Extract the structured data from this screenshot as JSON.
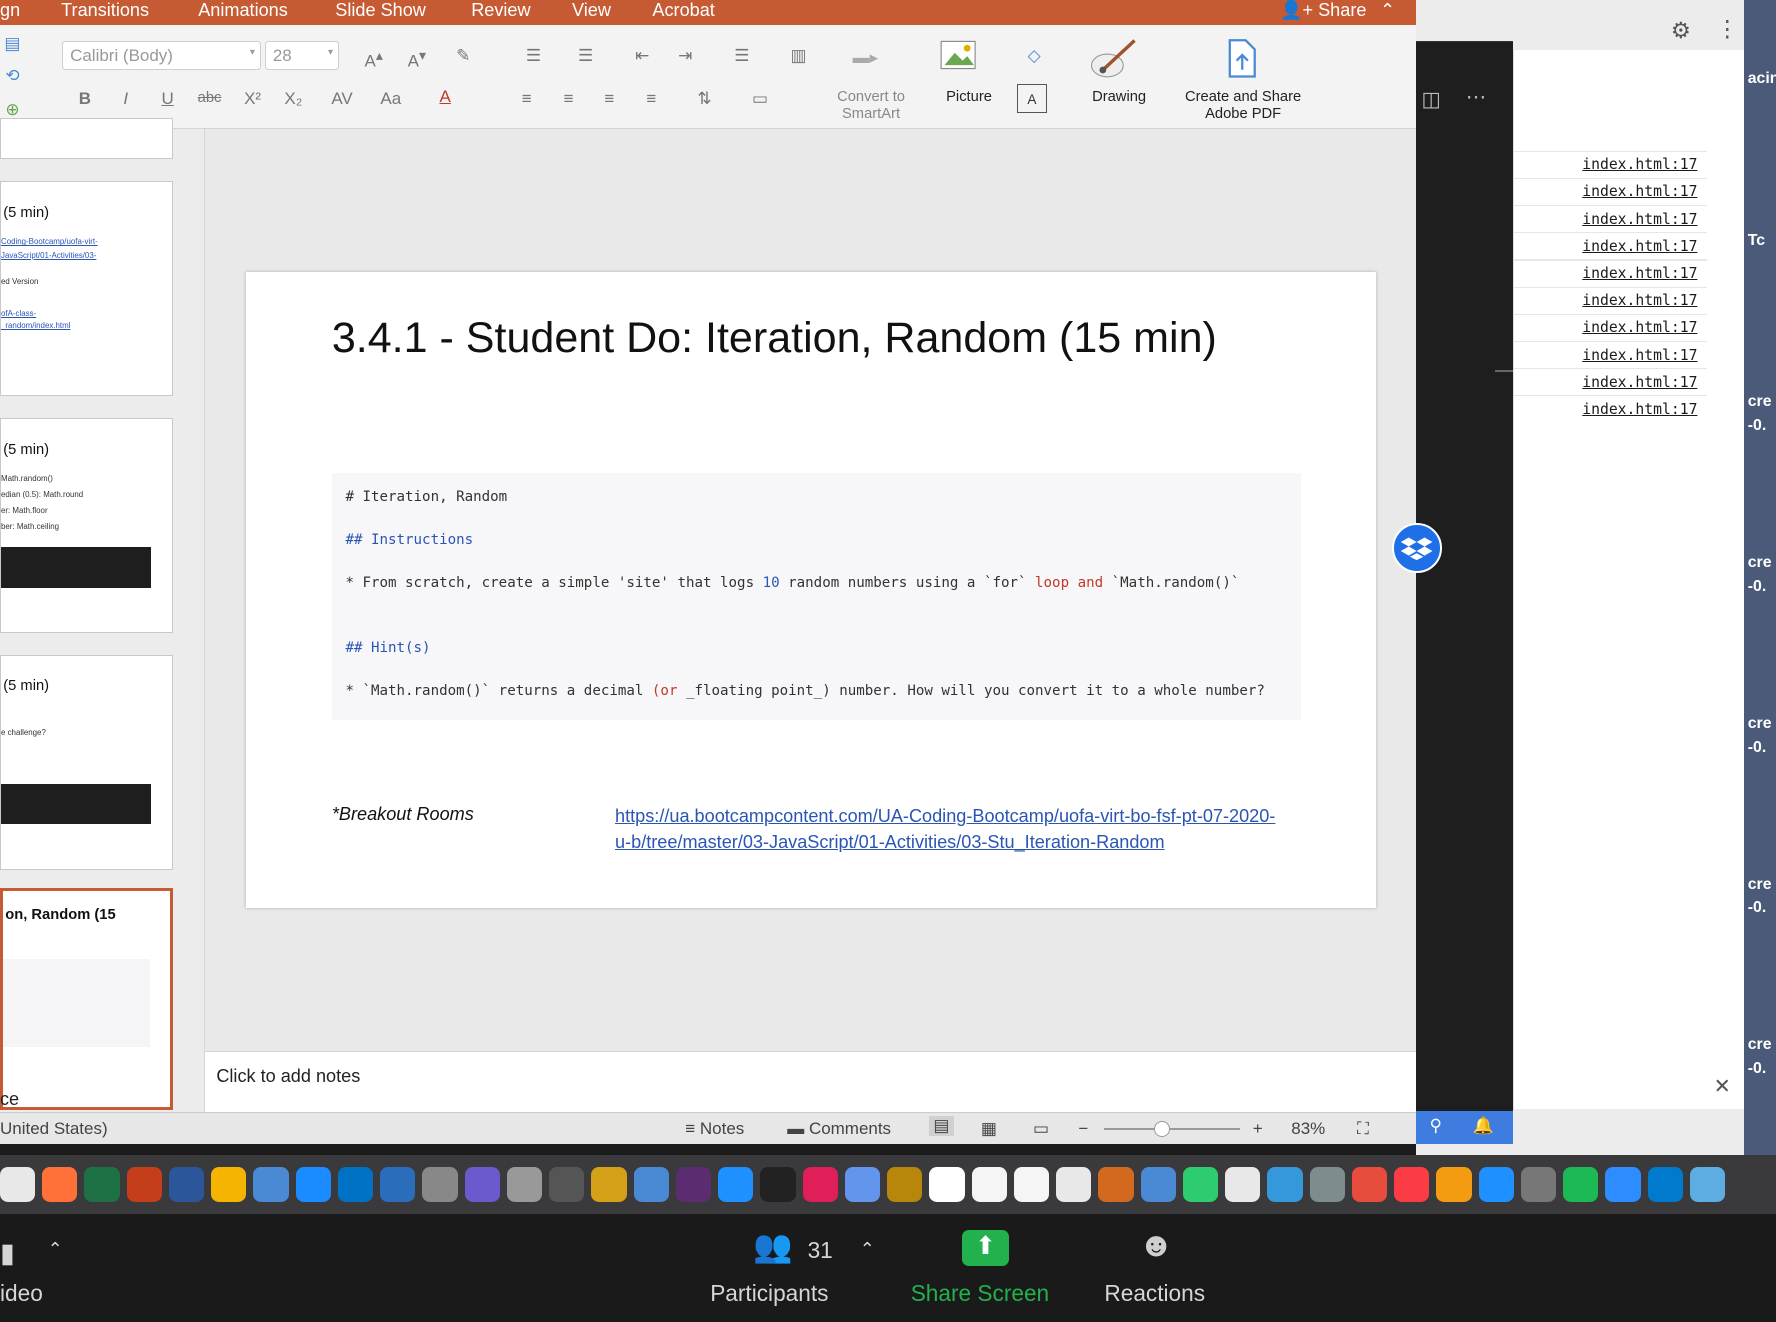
{
  "ppt": {
    "menu": [
      "gn",
      "Transitions",
      "Animations",
      "Slide Show",
      "Review",
      "View",
      "Acrobat"
    ],
    "share_label": "Share",
    "font_name": "Calibri (Body)",
    "font_size": "28",
    "ribbon_labels": {
      "convert_line1": "Convert to",
      "convert_line2": "SmartArt",
      "picture": "Picture",
      "drawing": "Drawing",
      "adobe_line1": "Create and Share",
      "adobe_line2": "Adobe PDF"
    }
  },
  "thumbnails": [
    {
      "title": "(5 min)",
      "lines": [
        "Coding-Bootcamp/uofa-virt-",
        "JavaScript/01-Activities/03-",
        "ed Version",
        "ofA-class-",
        "_random/index.html"
      ]
    },
    {
      "title": "(5 min)",
      "lines": [
        "Math.random()",
        "edian (0.5): Math.round",
        "er: Math.floor",
        "ber: Math.ceiling"
      ]
    },
    {
      "title": "(5 min)",
      "lines": [
        "e challenge?"
      ]
    },
    {
      "title": "on, Random (15",
      "lines": []
    }
  ],
  "slide": {
    "title": "3.4.1 - Student Do: Iteration, Random (15 min)",
    "code": {
      "h1": "# Iteration, Random",
      "h2_instructions": "## Instructions",
      "bullet1_a": "* From scratch, create a simple 'site' that logs ",
      "bullet1_num": "10",
      "bullet1_b": " random numbers using a `for` ",
      "bullet1_kw": "loop and",
      "bullet1_c": " `Math.random()`",
      "h2_hints": "## Hint(s)",
      "bullet2_a": "* `Math.random()` returns a decimal ",
      "bullet2_kw": "(or",
      "bullet2_b": " _floating point_) number. How will you convert it to a whole number?"
    },
    "breakout_label": "*Breakout Rooms",
    "breakout_link": "https://ua.bootcampcontent.com/UA-Coding-Bootcamp/uofa-virt-bo-fsf-pt-07-2020-u-b/tree/master/03-JavaScript/01-Activities/03-Stu_Iteration-Random"
  },
  "notes_placeholder": "Click to add notes",
  "status": {
    "thumb_ce": "ce",
    "language": "United States)",
    "notes": "Notes",
    "comments": "Comments",
    "zoom": "83%"
  },
  "console": {
    "link": "index.html:17",
    "desk_labels": [
      "acin",
      "Tc",
      "cre",
      "-0.",
      "cre",
      "-0.",
      "cre",
      "-0.",
      "cre",
      "-0.",
      "cre",
      "-0."
    ]
  },
  "zoom_bar": {
    "video": "ideo",
    "participants_count": "31",
    "participants": "Participants",
    "share_screen": "Share Screen",
    "reactions": "Reactions"
  },
  "colors": {
    "ppt_accent": "#c65a33",
    "link": "#2a55b5",
    "share_green": "#22b14c"
  }
}
